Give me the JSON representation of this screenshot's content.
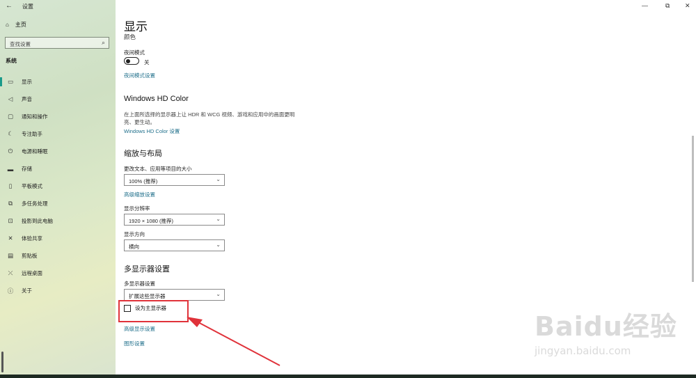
{
  "titlebar": {
    "back_icon": "back-arrow-icon",
    "title": "设置",
    "minimize": "—",
    "maximize": "⧉",
    "close": "✕"
  },
  "sidebar": {
    "home_label": "主页",
    "search_placeholder": "查找设置",
    "section_title": "系统",
    "items": [
      {
        "label": "显示",
        "icon": "monitor-icon",
        "active": true
      },
      {
        "label": "声音",
        "icon": "speaker-icon"
      },
      {
        "label": "通知和操作",
        "icon": "notification-icon"
      },
      {
        "label": "专注助手",
        "icon": "moon-icon"
      },
      {
        "label": "电源和睡眠",
        "icon": "power-icon"
      },
      {
        "label": "存储",
        "icon": "storage-icon"
      },
      {
        "label": "平板模式",
        "icon": "tablet-icon"
      },
      {
        "label": "多任务处理",
        "icon": "multitask-icon"
      },
      {
        "label": "投影到此电脑",
        "icon": "project-icon"
      },
      {
        "label": "体验共享",
        "icon": "share-icon"
      },
      {
        "label": "剪贴板",
        "icon": "clipboard-icon"
      },
      {
        "label": "远程桌面",
        "icon": "remote-icon"
      },
      {
        "label": "关于",
        "icon": "info-icon"
      }
    ]
  },
  "main": {
    "title": "显示",
    "subtitle": "颜色",
    "night_mode": {
      "label": "夜间模式",
      "state": "关",
      "link": "夜间模式设置"
    },
    "hdr": {
      "title": "Windows HD Color",
      "desc": "在上面所选择的显示器上让 HDR 和 WCG 视频、游戏和应用中的画面更明亮、更生动。",
      "link": "Windows HD Color 设置"
    },
    "scale": {
      "title": "缩放与布局",
      "text_size_label": "更改文本、应用等项目的大小",
      "text_size_value": "100% (推荐)",
      "advanced_link": "高级缩放设置",
      "resolution_label": "显示分辨率",
      "resolution_value": "1920 × 1080 (推荐)",
      "orientation_label": "显示方向",
      "orientation_value": "横向"
    },
    "multi": {
      "title": "多显示器设置",
      "label": "多显示器设置",
      "value": "扩展这些显示器",
      "primary_checkbox": "设为主显示器",
      "advanced_link": "高级显示设置",
      "graphics_link": "图形设置"
    }
  },
  "annotation": {
    "color": "#e0323a"
  },
  "watermark": {
    "main": "Baidu经验",
    "sub": "jingyan.baidu.com"
  }
}
